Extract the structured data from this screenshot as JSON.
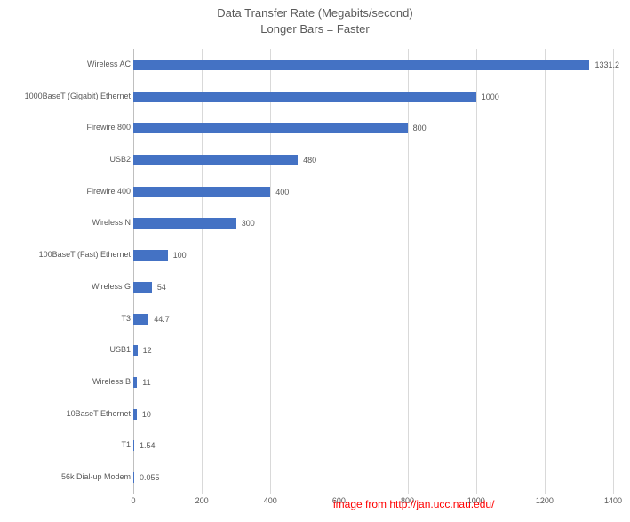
{
  "chart_data": {
    "type": "bar",
    "orientation": "horizontal",
    "title": "Data Transfer Rate (Megabits/second)",
    "subtitle": "Longer Bars = Faster",
    "xlabel": "",
    "ylabel": "",
    "xlim": [
      0,
      1400
    ],
    "x_ticks": [
      0,
      200,
      400,
      600,
      800,
      1000,
      1200,
      1400
    ],
    "categories": [
      "Wireless AC",
      "1000BaseT (Gigabit) Ethernet",
      "Firewire 800",
      "USB2",
      "Firewire 400",
      "Wireless N",
      "100BaseT (Fast) Ethernet",
      "Wireless G",
      "T3",
      "USB1",
      "Wireless B",
      "10BaseT Ethernet",
      "T1",
      "56k Dial-up Modem"
    ],
    "values": [
      1331.2,
      1000,
      800,
      480,
      400,
      300,
      100,
      54,
      44.7,
      12,
      11,
      10,
      1.54,
      0.055
    ],
    "bar_color": "#4472c4",
    "credit": "image from http://jan.ucc.nau.edu/"
  }
}
